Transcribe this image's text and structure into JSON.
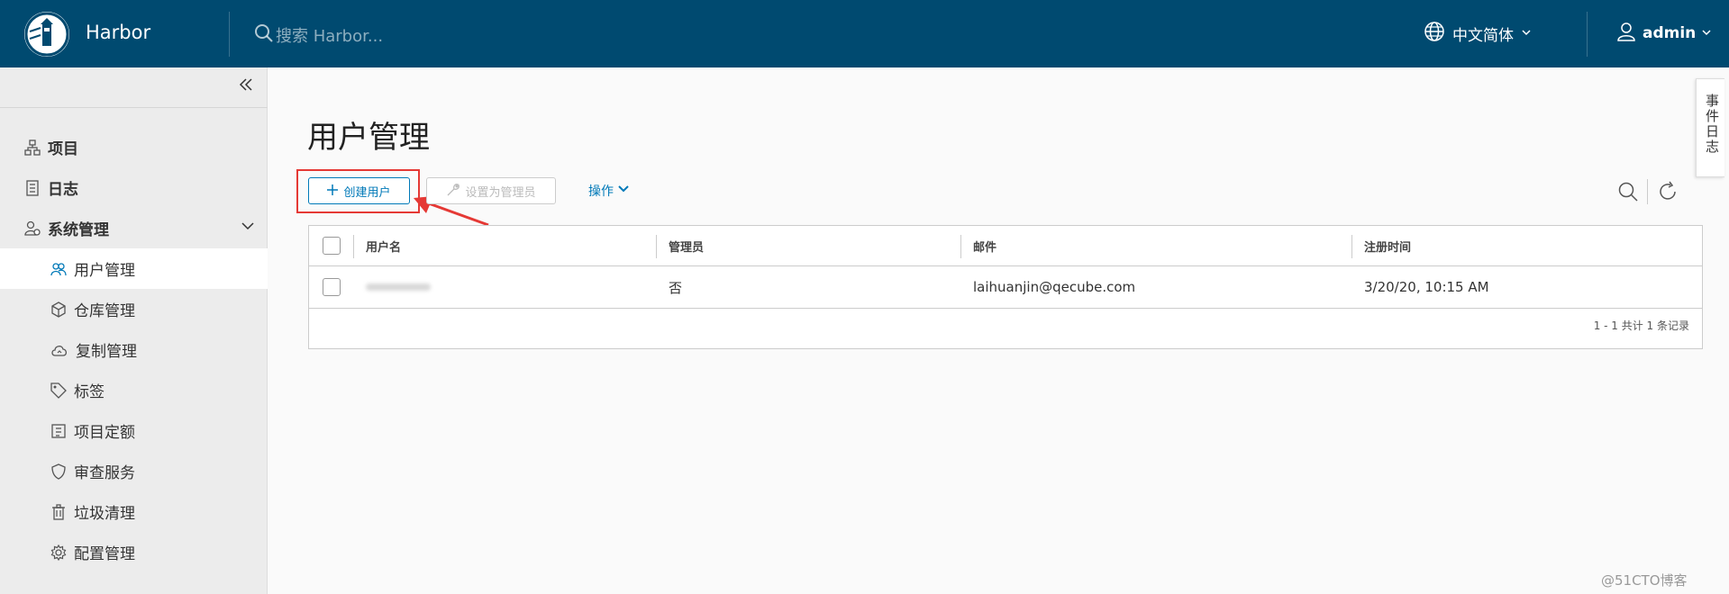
{
  "header": {
    "brand": "Harbor",
    "search_placeholder": "搜索 Harbor...",
    "language": "中文简体",
    "user": "admin"
  },
  "sidebar": {
    "items": [
      {
        "label": "项目",
        "icon": "project-icon"
      },
      {
        "label": "日志",
        "icon": "log-icon"
      },
      {
        "label": "系统管理",
        "icon": "system-admin-icon"
      }
    ],
    "sub_items": [
      {
        "label": "用户管理",
        "icon": "users-icon",
        "active": true
      },
      {
        "label": "仓库管理",
        "icon": "cube-icon"
      },
      {
        "label": "复制管理",
        "icon": "cloud-icon"
      },
      {
        "label": "标签",
        "icon": "tag-icon"
      },
      {
        "label": "项目定额",
        "icon": "quota-icon"
      },
      {
        "label": "审查服务",
        "icon": "shield-icon"
      },
      {
        "label": "垃圾清理",
        "icon": "trash-icon"
      },
      {
        "label": "配置管理",
        "icon": "gear-icon"
      }
    ]
  },
  "main": {
    "title": "用户管理",
    "create_button": "创建用户",
    "set_admin_button": "设置为管理员",
    "operations": "操作"
  },
  "table": {
    "columns": [
      "用户名",
      "管理员",
      "邮件",
      "注册时间"
    ],
    "rows": [
      {
        "username": "",
        "admin": "否",
        "email": "laihuanjin@qecube.com",
        "registered": "3/20/20, 10:15 AM"
      }
    ],
    "footer": "1 - 1 共计 1 条记录"
  },
  "right_tab": "事件日志",
  "watermark": "@51CTO博客",
  "colors": {
    "header_bg": "#004a70",
    "accent": "#0079b8",
    "highlight": "#e53935"
  }
}
